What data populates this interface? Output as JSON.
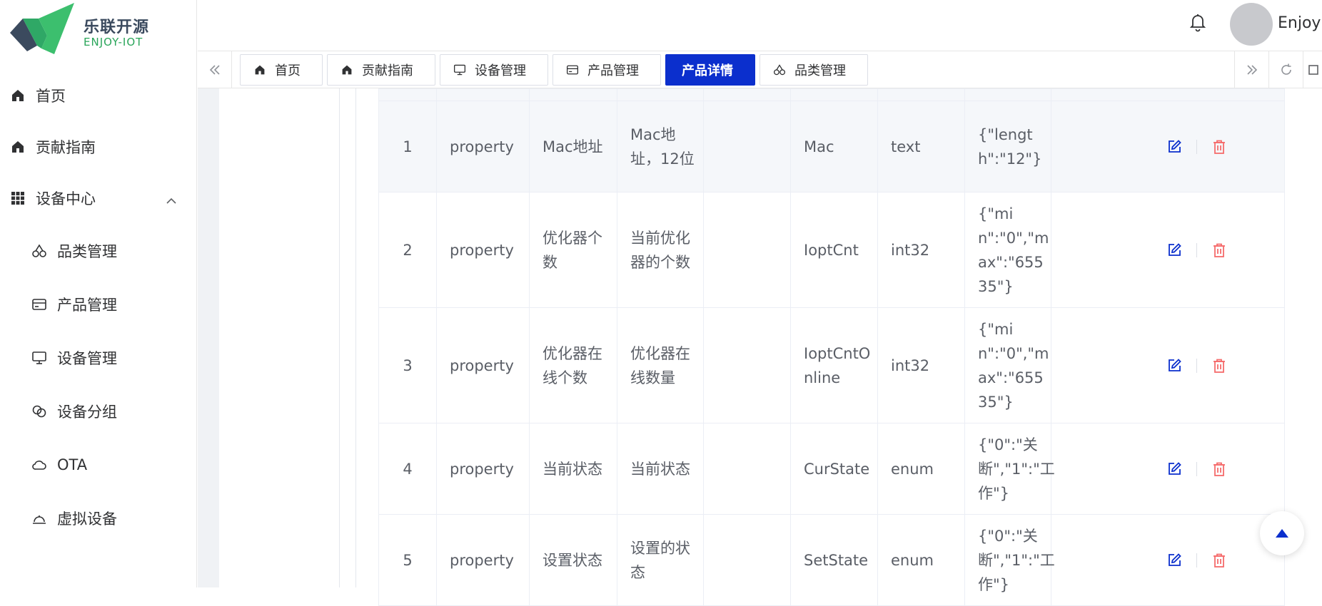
{
  "brand": {
    "title": "乐联开源",
    "subtitle": "ENJOY-IOT"
  },
  "sidebar": {
    "items": [
      {
        "label": "首页",
        "icon": "home-icon"
      },
      {
        "label": "贡献指南",
        "icon": "home-icon"
      },
      {
        "label": "设备中心",
        "icon": "grid-icon",
        "expanded": true
      }
    ],
    "sub_items": [
      {
        "label": "品类管理",
        "icon": "cherries-icon"
      },
      {
        "label": "产品管理",
        "icon": "card-icon"
      },
      {
        "label": "设备管理",
        "icon": "monitor-icon"
      },
      {
        "label": "设备分组",
        "icon": "link-icon"
      },
      {
        "label": "OTA",
        "icon": "cloud-icon"
      },
      {
        "label": "虚拟设备",
        "icon": "bell-dome-icon"
      }
    ]
  },
  "header": {
    "username": "Enjoyl"
  },
  "tabs": [
    {
      "label": "首页",
      "icon": "home-icon",
      "active": false
    },
    {
      "label": "贡献指南",
      "icon": "home-icon",
      "active": false
    },
    {
      "label": "设备管理",
      "icon": "monitor-icon",
      "active": false
    },
    {
      "label": "产品管理",
      "icon": "card-icon",
      "active": false
    },
    {
      "label": "产品详情",
      "icon": "",
      "active": true
    },
    {
      "label": "品类管理",
      "icon": "cherries-icon",
      "active": false
    }
  ],
  "table": {
    "rows": [
      {
        "no": "1",
        "type": "property",
        "name": "Mac地址",
        "desc": "Mac地址，12位",
        "extra": "",
        "identifier": "Mac",
        "datatype": "text",
        "spec": "{\"length\":\"12\"}"
      },
      {
        "no": "2",
        "type": "property",
        "name": "优化器个数",
        "desc": "当前优化器的个数",
        "extra": "",
        "identifier": "IoptCnt",
        "datatype": "int32",
        "spec": "{\"min\":\"0\",\"max\":\"65535\"}"
      },
      {
        "no": "3",
        "type": "property",
        "name": "优化器在线个数",
        "desc": "优化器在线数量",
        "extra": "",
        "identifier": "IoptCntOnline",
        "datatype": "int32",
        "spec": "{\"min\":\"0\",\"max\":\"65535\"}"
      },
      {
        "no": "4",
        "type": "property",
        "name": "当前状态",
        "desc": "当前状态",
        "extra": "",
        "identifier": "CurState",
        "datatype": "enum",
        "spec": "{\"0\":\"关断\",\"1\":\"工作\"}"
      },
      {
        "no": "5",
        "type": "property",
        "name": "设置状态",
        "desc": "设置的状态",
        "extra": "",
        "identifier": "SetState",
        "datatype": "enum",
        "spec": "{\"0\":\"关断\",\"1\":\"工作\"}"
      }
    ]
  },
  "colors": {
    "accent": "#0b2fcd",
    "edit": "#0b2fcd",
    "delete": "#f56c6c",
    "brand_green": "#2aa55a"
  }
}
